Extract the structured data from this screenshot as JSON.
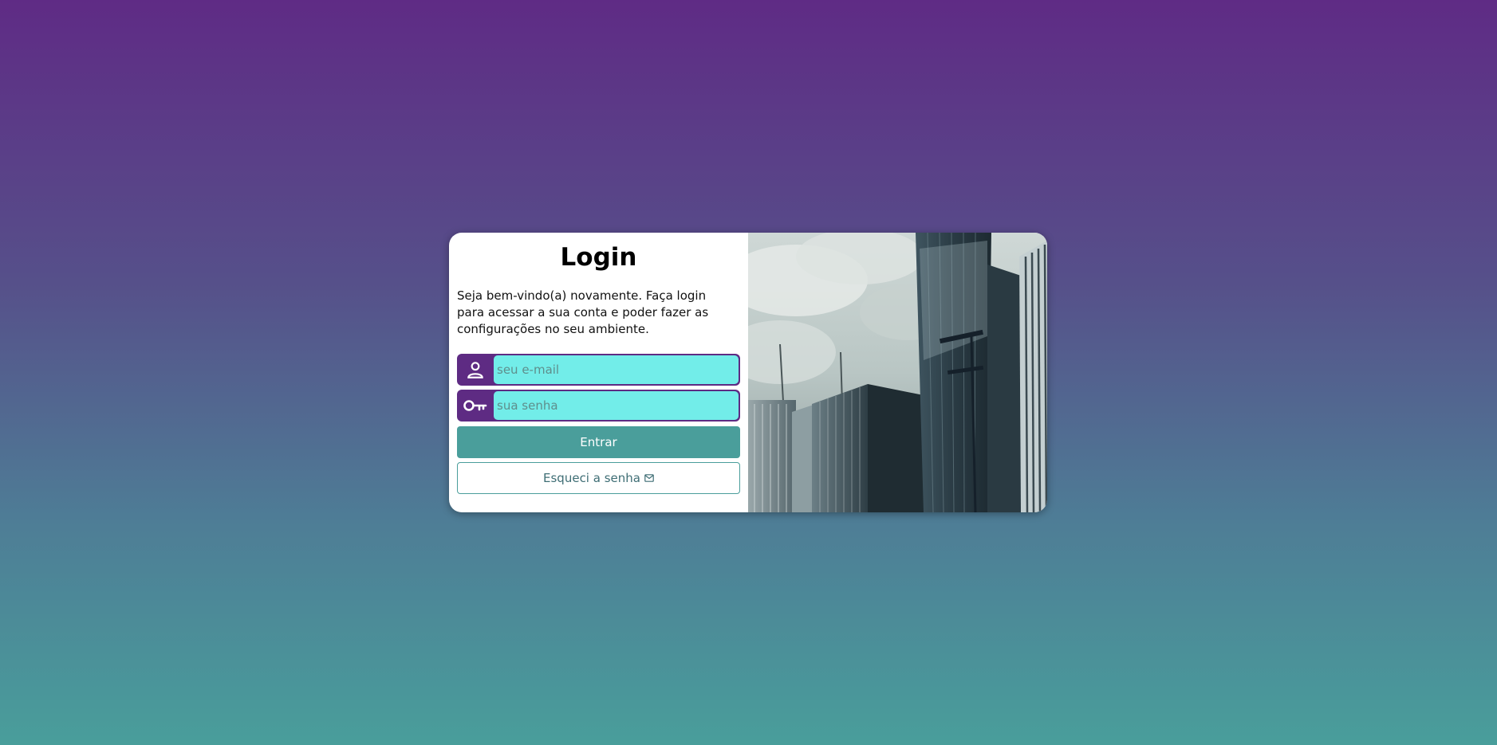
{
  "login": {
    "title": "Login",
    "welcome_text": "Seja bem-vindo(a) novamente. Faça login para acessar a sua conta e poder fazer as configurações no seu ambiente.",
    "email": {
      "icon": "user-icon",
      "placeholder": "seu e-mail",
      "value": ""
    },
    "password": {
      "icon": "key-icon",
      "placeholder": "sua senha",
      "value": ""
    },
    "submit_label": "Entrar",
    "forgot_label": "Esqueci a senha",
    "forgot_icon": "envelope-icon"
  },
  "colors": {
    "accent_purple": "#5e2b83",
    "input_fill": "#72ede9",
    "teal_button": "#4a9e9b"
  },
  "side_image": {
    "subject": "buildings-photo"
  }
}
